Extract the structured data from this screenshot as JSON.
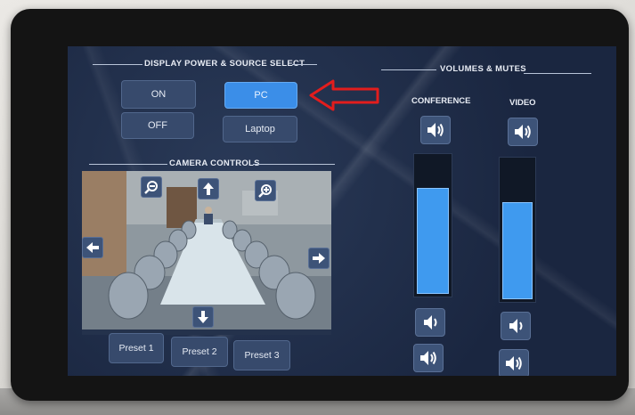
{
  "display": {
    "title": "DISPLAY POWER & SOURCE SELECT",
    "on_label": "ON",
    "off_label": "OFF",
    "pc_label": "PC",
    "laptop_label": "Laptop",
    "active_source": "PC"
  },
  "camera": {
    "title": "CAMERA CONTROLS",
    "presets": [
      "Preset 1",
      "Preset 2",
      "Preset 3"
    ],
    "icons": [
      "zoom-out-icon",
      "arrow-up-icon",
      "zoom-in-icon",
      "arrow-left-icon",
      "arrow-right-icon",
      "arrow-down-icon"
    ]
  },
  "volumes": {
    "title": "VOLUMES & MUTES",
    "channels": [
      {
        "label": "CONFERENCE",
        "level": 0.78
      },
      {
        "label": "VIDEO",
        "level": 0.71
      }
    ],
    "icons": [
      "speaker-mute-icon",
      "speaker-down-icon",
      "speaker-up-icon"
    ]
  },
  "colors": {
    "active_button": "#3b8ee8",
    "button": "#374a6c",
    "screen_background": "#1e2b44",
    "annotation_arrow": "#e21d1d"
  },
  "annotation": "red-arrow-icon"
}
